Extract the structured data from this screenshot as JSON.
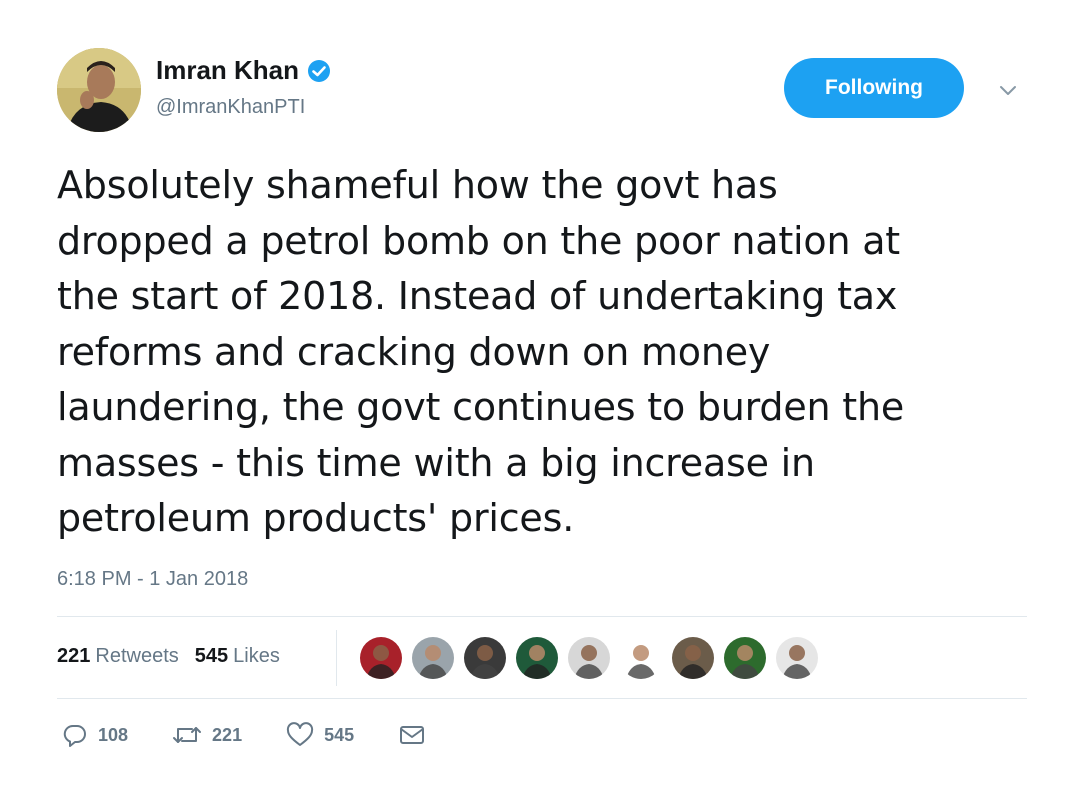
{
  "author": {
    "display_name": "Imran Khan",
    "handle": "@ImranKhanPTI",
    "verified": true,
    "avatar_icon": "avatar"
  },
  "follow_button": {
    "label": "Following"
  },
  "tweet": {
    "text": "Absolutely shameful how the govt has\ndropped a petrol bomb on the poor nation at\nthe start of 2018. Instead  of undertaking tax\nreforms and cracking down on money\nlaundering, the govt continues to burden the\nmasses - this time with a big increase in\npetroleum products' prices.",
    "timestamp": "6:18 PM - 1 Jan 2018"
  },
  "stats": {
    "retweets_count": "221",
    "retweets_label": "Retweets",
    "likes_count": "545",
    "likes_label": "Likes"
  },
  "likers": [
    {
      "name": "liker-1",
      "color": "#a8212a"
    },
    {
      "name": "liker-2",
      "color": "#9aa4ab"
    },
    {
      "name": "liker-3",
      "color": "#3a3a3a"
    },
    {
      "name": "liker-4",
      "color": "#1f5a3a"
    },
    {
      "name": "liker-5",
      "color": "#d7d7d7"
    },
    {
      "name": "liker-6",
      "color": "#ffffff"
    },
    {
      "name": "liker-7",
      "color": "#6b5c4a"
    },
    {
      "name": "liker-8",
      "color": "#2d6b2d"
    },
    {
      "name": "liker-9",
      "color": "#e6e6e6"
    }
  ],
  "actions": {
    "reply_count": "108",
    "retweet_count": "221",
    "like_count": "545"
  },
  "colors": {
    "accent": "#1da1f2",
    "text": "#14171a",
    "muted": "#657786",
    "divider": "#e1e8ed"
  }
}
